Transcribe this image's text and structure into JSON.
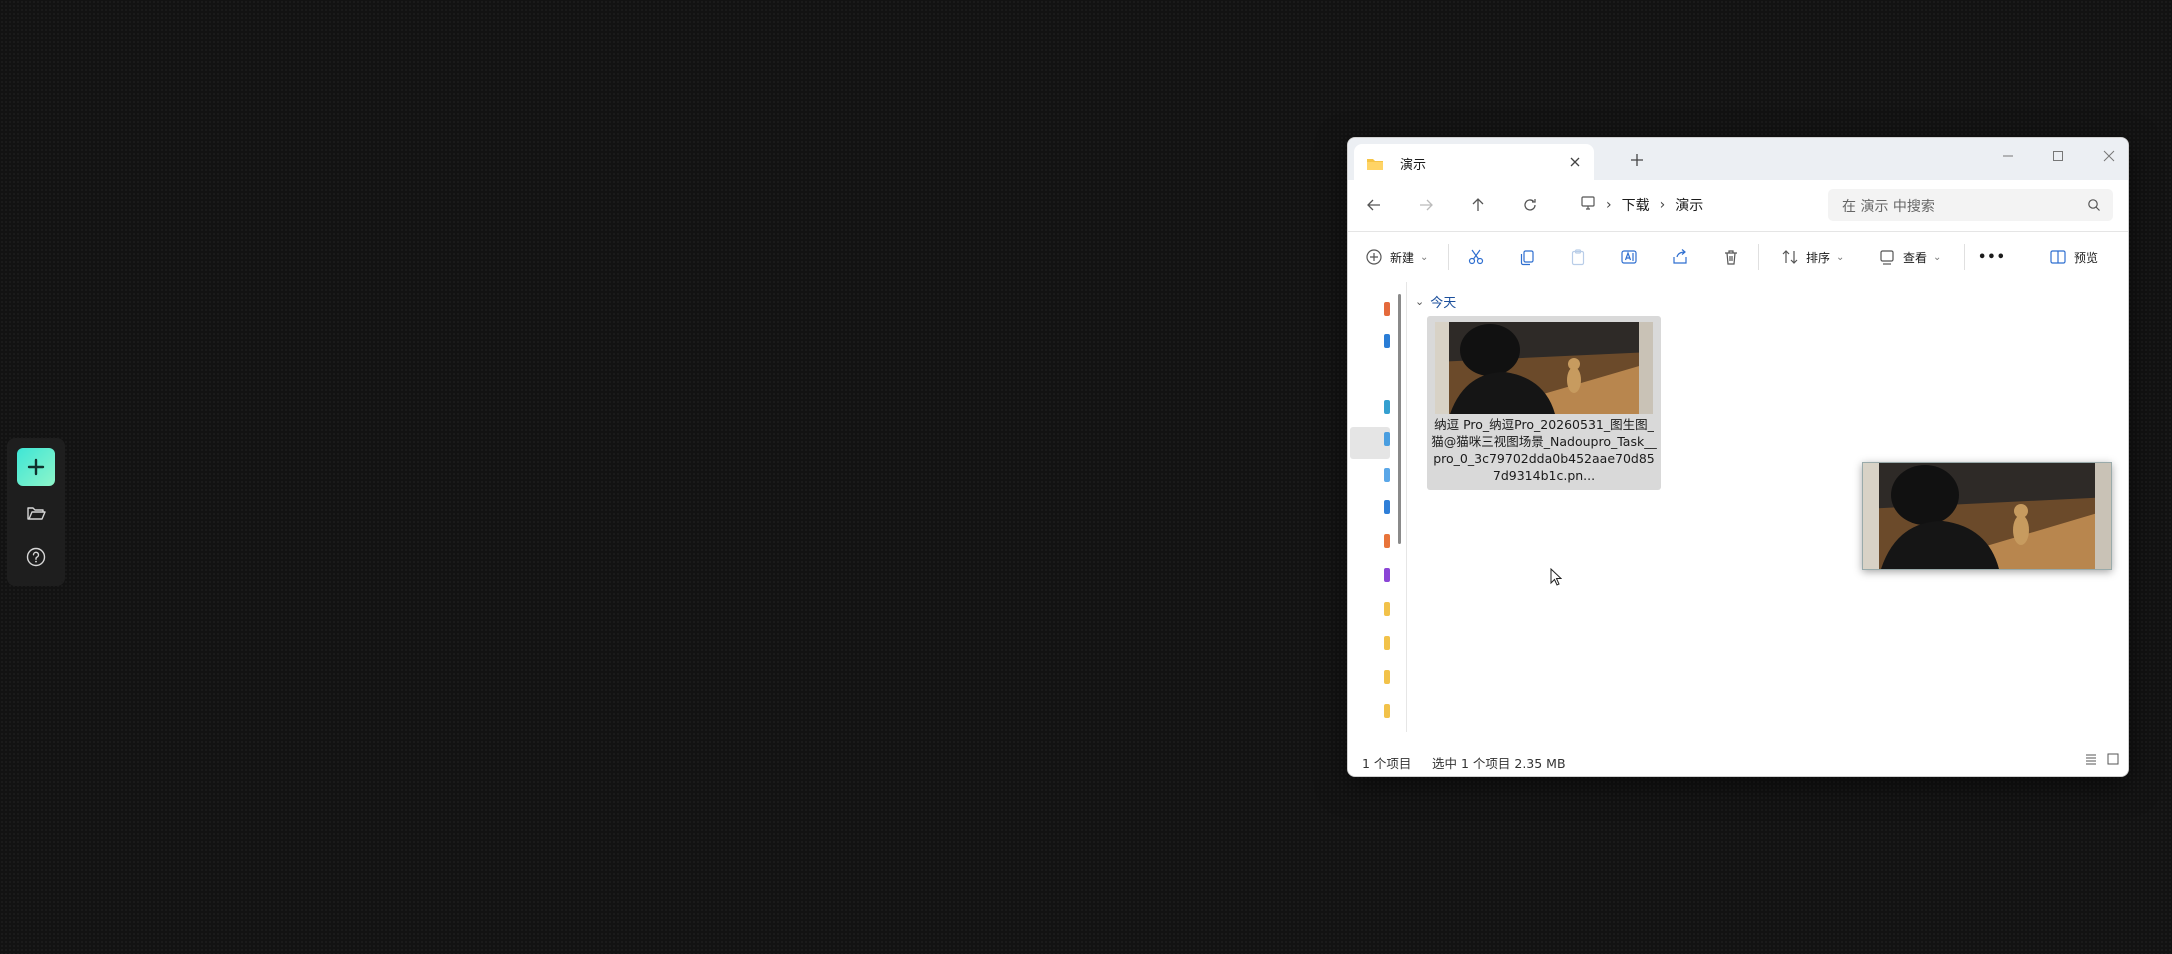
{
  "toolbar": {
    "new_icon": "plus-icon",
    "open_icon": "folder-open-icon",
    "help_icon": "help-circle-icon"
  },
  "window": {
    "tab_title": "演示",
    "new_tab": "+",
    "breadcrumb": [
      "下载",
      "演示"
    ],
    "search_placeholder": "在 演示 中搜索",
    "commands": {
      "new": "新建",
      "sort": "排序",
      "view": "查看",
      "more": "•••",
      "preview": "预览"
    },
    "group_header": "今天",
    "file": {
      "name": "纳逗 Pro_纳逗Pro_20260531_图生图_猫@猫咪三视图场景_Nadoupro_Task__pro_0_3c79702dda0b452aae70d857d9314b1c.pn..."
    },
    "status": {
      "count": "1 个项目",
      "selection": "选中 1 个项目  2.35 MB"
    }
  },
  "colors": {
    "desktop_bg": "#121212",
    "accent": "#3ee6d6",
    "selection": "#d9d9d9",
    "link_blue": "#1b4f9c"
  }
}
